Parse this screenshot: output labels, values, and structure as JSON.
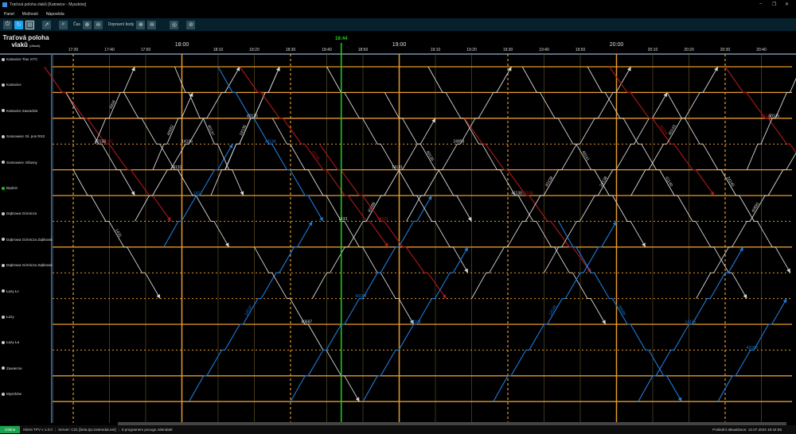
{
  "window": {
    "title": "Traťová poloha vlaků [Katowice - Myszków]",
    "minimize": "–",
    "maximize": "❐",
    "close": "✕"
  },
  "menu": [
    "Panel",
    "Možnosti",
    "Nápověda"
  ],
  "toolbar": {
    "buttons_left": [
      "power-icon",
      "refresh-icon",
      "calendar-icon",
      "expand-icon",
      "zoom-icon"
    ],
    "cas_label": "Čas",
    "dopravni_label": "Dopravní body",
    "icons_right": [
      "globe-icon",
      "clear-icon"
    ]
  },
  "header": {
    "title_line1": "Traťová poloha",
    "title_line2": "vlaků",
    "title_suffix": "(dílové)"
  },
  "time_axis": {
    "labels": [
      "17:30",
      "17:40",
      "17:50",
      "18:00",
      "18:10",
      "18:20",
      "18:30",
      "18:40",
      "18:50",
      "19:00",
      "19:10",
      "19:20",
      "19:30",
      "19:40",
      "19:50",
      "20:00",
      "20:10",
      "20:20",
      "20:30",
      "20:40"
    ],
    "now": "18:44"
  },
  "stations": [
    {
      "name": "Katowice Tow. KTC",
      "active": false,
      "dotted": false
    },
    {
      "name": "Katowice",
      "active": false,
      "dotted": false
    },
    {
      "name": "Katowice Zawodzie",
      "active": false,
      "dotted": false
    },
    {
      "name": "Sosnowiec Gł. pos RS2",
      "active": false,
      "dotted": true
    },
    {
      "name": "Sosnowiec Główny",
      "active": false,
      "dotted": false
    },
    {
      "name": "Będzin",
      "active": true,
      "dotted": false
    },
    {
      "name": "Dąbrowa Górnicza",
      "active": false,
      "dotted": true
    },
    {
      "name": "Dąbrowa Górnicza Ząbkowice",
      "active": false,
      "dotted": false
    },
    {
      "name": "Dąbrowa Górnicza Ząbkowice",
      "active": false,
      "dotted": true
    },
    {
      "name": "Łazy Łc",
      "active": false,
      "dotted": true
    },
    {
      "name": "Łazy",
      "active": false,
      "dotted": false
    },
    {
      "name": "Łazy Ła",
      "active": false,
      "dotted": true
    },
    {
      "name": "Zawiercie",
      "active": false,
      "dotted": false
    },
    {
      "name": "Myszków",
      "active": false,
      "dotted": false
    }
  ],
  "colors": {
    "white": "#d8d8d8",
    "blue": "#1f7ad6",
    "red": "#b01818",
    "grid": "#e59a2e",
    "now": "#22cc22"
  },
  "trains": [
    {
      "no": "44101",
      "color": "red",
      "start": "17:22",
      "from": 0,
      "to": 6,
      "step": 5
    },
    {
      "no": "40133",
      "color": "white",
      "start": "17:28",
      "from": 1,
      "to": 5,
      "step": 4
    },
    {
      "no": "6934",
      "color": "white",
      "start": "17:36",
      "from": 3,
      "to": 0,
      "step": 3
    },
    {
      "no": "1431",
      "color": "white",
      "start": "17:30",
      "from": 4,
      "to": 9,
      "step": 4
    },
    {
      "no": "24131",
      "color": "white",
      "start": "17:44",
      "from": 1,
      "to": 7,
      "step": 4
    },
    {
      "no": "14136",
      "color": "white",
      "start": "17:47",
      "from": 6,
      "to": 0,
      "step": 4
    },
    {
      "no": "40682",
      "color": "white",
      "start": "17:52",
      "from": 4,
      "to": 1,
      "step": 3
    },
    {
      "no": "1417",
      "color": "blue",
      "start": "17:55",
      "from": 7,
      "to": 3,
      "step": 4
    },
    {
      "no": "40137",
      "color": "white",
      "start": "17:58",
      "from": 0,
      "to": 5,
      "step": 3
    },
    {
      "no": "24136",
      "color": "white",
      "start": "18:08",
      "from": 5,
      "to": 0,
      "step": 3
    },
    {
      "no": "41134",
      "color": "blue",
      "start": "18:10",
      "from": 0,
      "to": 6,
      "step": 4
    },
    {
      "no": "40135",
      "color": "white",
      "start": "18:12",
      "from": 4,
      "to": 0,
      "step": 3
    },
    {
      "no": "41136",
      "color": "red",
      "start": "18:16",
      "from": 0,
      "to": 7,
      "step": 5
    },
    {
      "no": "14137",
      "color": "blue",
      "start": "18:02",
      "from": 13,
      "to": 6,
      "step": 4
    },
    {
      "no": "40687",
      "color": "white",
      "start": "18:20",
      "from": 7,
      "to": 13,
      "step": 4
    },
    {
      "no": "1433",
      "color": "white",
      "start": "18:25",
      "from": 2,
      "to": 10,
      "step": 4
    },
    {
      "no": "43104",
      "color": "blue",
      "start": "18:30",
      "from": 13,
      "to": 5,
      "step": 4
    },
    {
      "no": "40686",
      "color": "white",
      "start": "18:36",
      "from": 9,
      "to": 2,
      "step": 4
    },
    {
      "no": "14131",
      "color": "white",
      "start": "18:40",
      "from": 0,
      "to": 8,
      "step": 4
    },
    {
      "no": "44102",
      "color": "red",
      "start": "18:38",
      "from": 3,
      "to": 9,
      "step": 5
    },
    {
      "no": "13104",
      "color": "blue",
      "start": "18:50",
      "from": 13,
      "to": 7,
      "step": 4
    },
    {
      "no": "40139",
      "color": "white",
      "start": "18:56",
      "from": 1,
      "to": 6,
      "step": 4
    },
    {
      "no": "24903",
      "color": "white",
      "start": "19:02",
      "from": 6,
      "to": 0,
      "step": 4
    },
    {
      "no": "41138",
      "color": "white",
      "start": "19:08",
      "from": 0,
      "to": 10,
      "step": 4
    },
    {
      "no": "43106",
      "color": "red",
      "start": "19:18",
      "from": 2,
      "to": 8,
      "step": 5
    },
    {
      "no": "40138",
      "color": "white",
      "start": "19:20",
      "from": 9,
      "to": 0,
      "step": 4
    },
    {
      "no": "14133",
      "color": "blue",
      "start": "19:26",
      "from": 13,
      "to": 6,
      "step": 4
    },
    {
      "no": "40141",
      "color": "white",
      "start": "19:34",
      "from": 0,
      "to": 7,
      "step": 4
    },
    {
      "no": "24138",
      "color": "white",
      "start": "19:40",
      "from": 8,
      "to": 1,
      "step": 4
    },
    {
      "no": "40689",
      "color": "blue",
      "start": "19:44",
      "from": 6,
      "to": 13,
      "step": 4
    },
    {
      "no": "41140",
      "color": "white",
      "start": "19:52",
      "from": 0,
      "to": 9,
      "step": 4
    },
    {
      "no": "44104",
      "color": "red",
      "start": "19:58",
      "from": 0,
      "to": 5,
      "step": 5
    },
    {
      "no": "40143",
      "color": "white",
      "start": "20:04",
      "from": 5,
      "to": 0,
      "step": 4
    },
    {
      "no": "14135",
      "color": "blue",
      "start": "20:06",
      "from": 13,
      "to": 7,
      "step": 4
    },
    {
      "no": "24140",
      "color": "white",
      "start": "20:14",
      "from": 1,
      "to": 8,
      "step": 4
    },
    {
      "no": "40691",
      "color": "white",
      "start": "20:22",
      "from": 9,
      "to": 2,
      "step": 4
    },
    {
      "no": "43108",
      "color": "blue",
      "start": "20:28",
      "from": 13,
      "to": 9,
      "step": 4
    },
    {
      "no": "41142",
      "color": "red",
      "start": "20:30",
      "from": 0,
      "to": 4,
      "step": 5
    },
    {
      "no": "40145",
      "color": "white",
      "start": "20:36",
      "from": 4,
      "to": 0,
      "step": 3
    }
  ],
  "status": {
    "online": "Online",
    "client": "Klient TPV v 1.0.0",
    "server": "Server: CZ1 [beta.tpv.zatemdat.net]",
    "message": "5 programem pocugo zdendaté",
    "updated": "Poslední aktualizace: 12.07.2024 18:44:55"
  }
}
